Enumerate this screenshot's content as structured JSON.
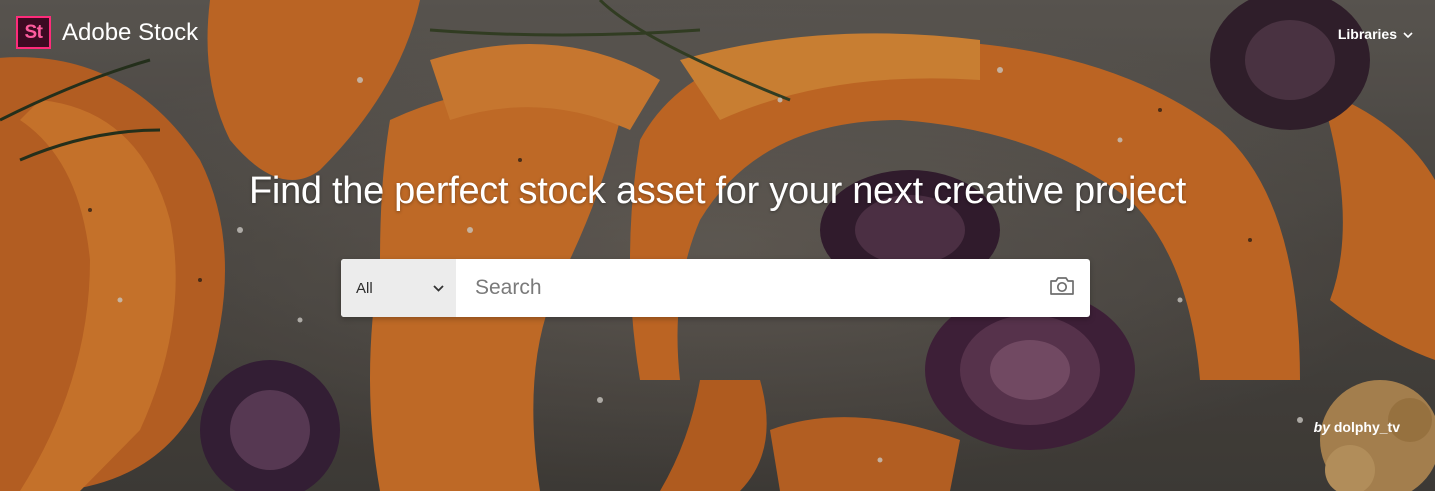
{
  "header": {
    "logo_badge": "St",
    "logo_text": "Adobe Stock",
    "libraries_label": "Libraries"
  },
  "hero": {
    "headline": "Find the perfect stock asset for your next creative project",
    "credit_prefix": "by",
    "credit_author": "dolphy_tv"
  },
  "search": {
    "scope_selected": "All",
    "placeholder": "Search"
  },
  "icons": {
    "scope_dropdown": "chevron-down-icon",
    "libraries_dropdown": "chevron-down-icon",
    "visual_search": "camera-icon"
  },
  "colors": {
    "brand_badge_bg": "#3d0a22",
    "brand_badge_border": "#ff2b7a",
    "squash": "#e07a2a",
    "onion": "#4a2a4a"
  }
}
